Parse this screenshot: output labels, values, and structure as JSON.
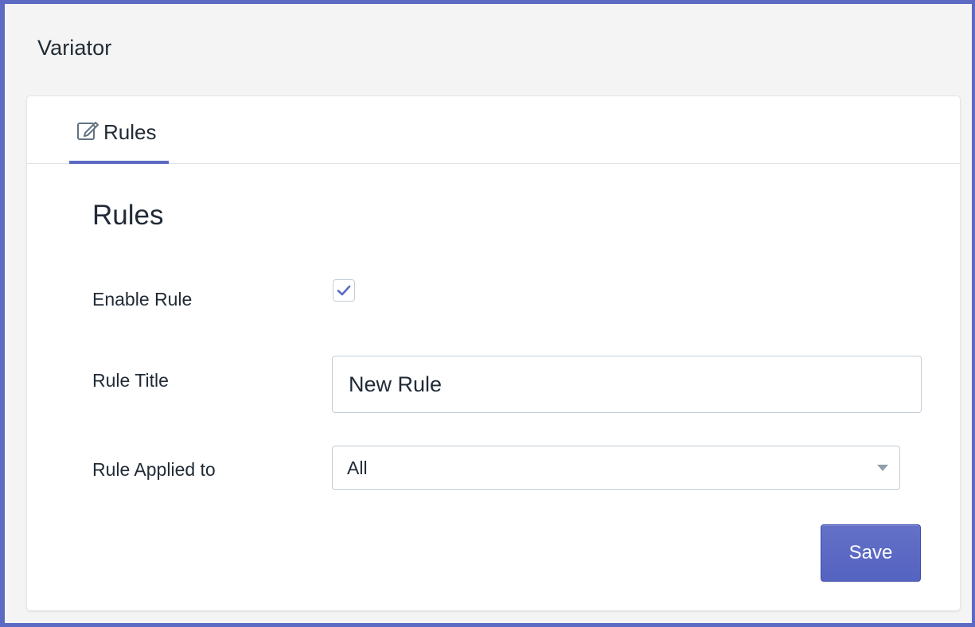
{
  "app": {
    "title": "Variator"
  },
  "tabs": [
    {
      "label": "Rules",
      "icon": "edit-icon",
      "active": true
    }
  ],
  "section": {
    "title": "Rules"
  },
  "form": {
    "enable_rule": {
      "label": "Enable Rule",
      "checked": true
    },
    "rule_title": {
      "label": "Rule Title",
      "value": "New Rule"
    },
    "rule_applied_to": {
      "label": "Rule Applied to",
      "selected": "All"
    },
    "save_label": "Save"
  },
  "colors": {
    "accent": "#5c6ac4",
    "background": "#f4f4f4",
    "text": "#212b36"
  }
}
